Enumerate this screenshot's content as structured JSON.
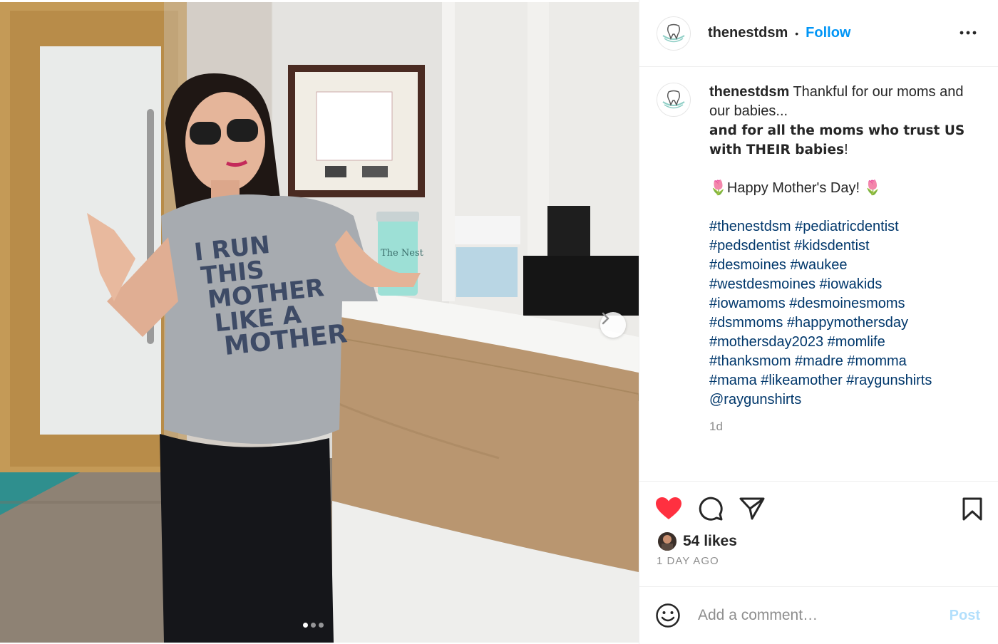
{
  "post": {
    "username": "thenestdsm",
    "follow_label": "Follow",
    "separator": "•",
    "caption_intro": "Thankful for our moms and our babies...",
    "caption_bold": "and for all the moms who trust US with THEIR babies",
    "caption_bold_end": "!",
    "greeting": "Happy Mother's Day!",
    "tulip": "🌷",
    "hashtags": [
      "#thenestdsm #pediatricdentist",
      "#pedsdentist #kidsdentist",
      "#desmoines #waukee",
      "#westdesmoines #iowakids",
      "#iowamoms #desmoinesmoms",
      "#dsmmoms #happymothersday",
      "#mothersday2023 #momlife",
      "#thanksmom #madre #momma",
      "#mama #likeamother #raygunshirts",
      "@raygunshirts"
    ],
    "caption_age": "1d",
    "likes": "54 likes",
    "time_ago": "1 DAY AGO",
    "liked": true
  },
  "photo": {
    "shirt_text": [
      "I RUN",
      "THIS",
      "MOTHER",
      "LIKE A",
      "MOTHER"
    ],
    "tumbler_text": "The Nest",
    "carousel": {
      "total": 3,
      "current": 1
    }
  },
  "comment": {
    "placeholder": "Add a comment…",
    "post_label": "Post"
  },
  "colors": {
    "follow": "#0095f6",
    "hashtag": "#00376b",
    "heart": "#ff3040",
    "muted": "#8e8e8e",
    "post_disabled": "#b2dffc"
  },
  "icons": [
    "logo-tooth-icon",
    "more-icon",
    "chevron-right-icon",
    "heart-icon",
    "comment-icon",
    "share-icon",
    "bookmark-icon",
    "emoji-icon"
  ]
}
